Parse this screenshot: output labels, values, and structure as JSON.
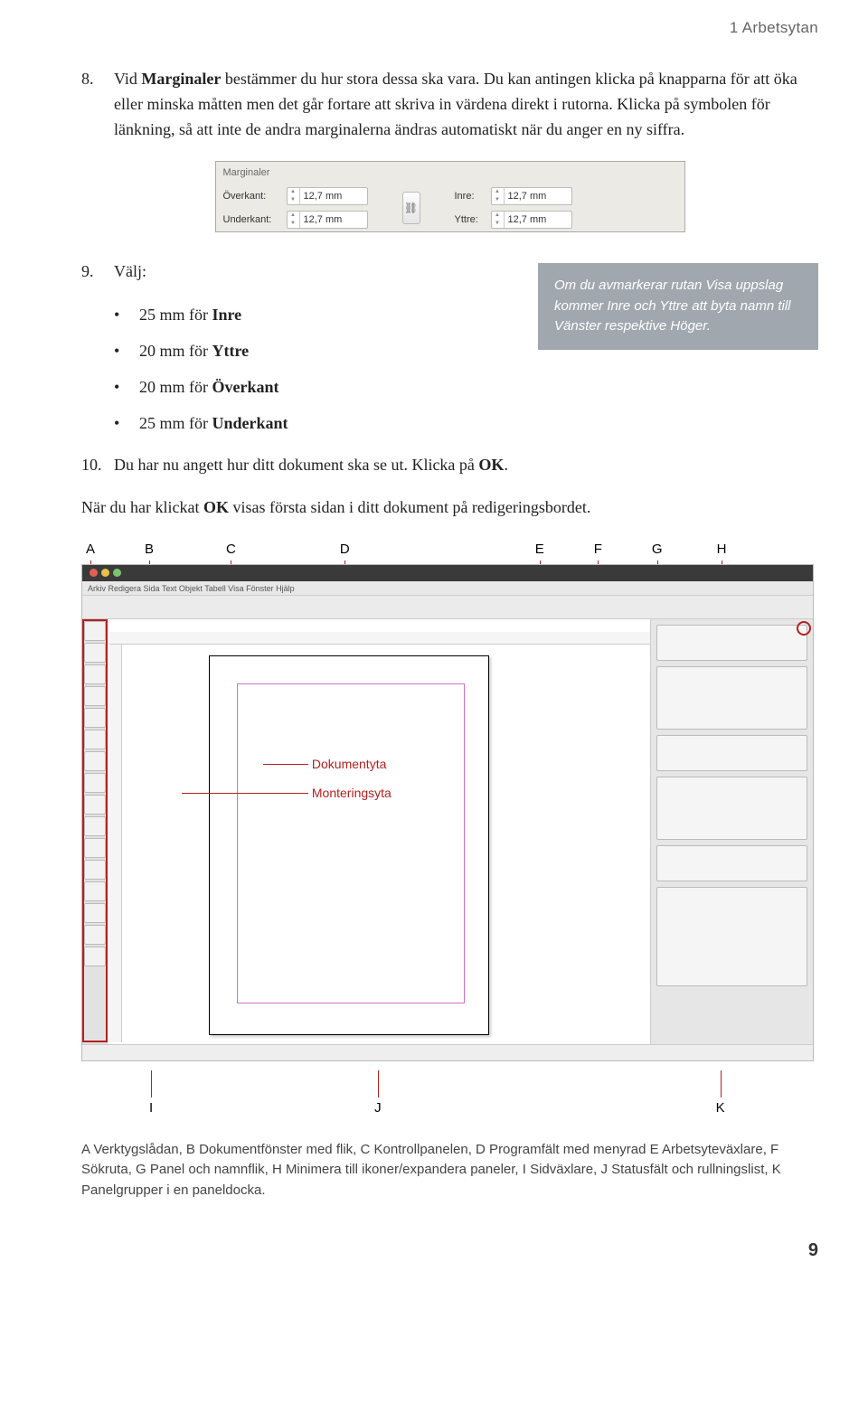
{
  "header": {
    "section_title": "1 Arbetsytan"
  },
  "step8": {
    "num": "8.",
    "text_before_bold": "Vid ",
    "bold1": "Marginaler",
    "text_after": " bestämmer du hur stora dessa ska vara. Du kan antingen klicka på knapparna för att öka eller minska måtten men det går fortare att skriva in värdena direkt i rutorna. Klicka på symbolen för länkning, så att inte de andra marginalerna ändras automatiskt när du anger en ny siffra."
  },
  "margins_panel": {
    "title": "Marginaler",
    "overkant_lbl": "Överkant:",
    "overkant_val": "12,7 mm",
    "underkant_lbl": "Underkant:",
    "underkant_val": "12,7 mm",
    "inre_lbl": "Inre:",
    "inre_val": "12,7 mm",
    "yttre_lbl": "Yttre:",
    "yttre_val": "12,7 mm"
  },
  "step9": {
    "num": "9.",
    "intro": "Välj:",
    "bullets": [
      {
        "prefix": "25 mm för ",
        "bold": "Inre"
      },
      {
        "prefix": "20 mm för ",
        "bold": "Yttre"
      },
      {
        "prefix": "20 mm för ",
        "bold": "Överkant"
      },
      {
        "prefix": "25 mm för ",
        "bold": "Underkant"
      }
    ]
  },
  "note": {
    "text": "Om du avmarkerar rutan Visa uppslag kommer Inre och Yttre att byta namn till Vänster respektive Höger."
  },
  "step10": {
    "num": "10.",
    "text": "Du har nu angett hur ditt dokument ska se ut. Klicka på ",
    "bold": "OK",
    "after": "."
  },
  "para_after": {
    "t1": "När du har klickat ",
    "b": "OK",
    "t2": " visas första sidan i ditt dokument på redigeringsbordet."
  },
  "diagram": {
    "top_labels": [
      "A",
      "B",
      "C",
      "D",
      "E",
      "F",
      "G",
      "H"
    ],
    "bottom_labels": [
      "I",
      "J",
      "K"
    ],
    "callout_doku": "Dokumentyta",
    "callout_mont": "Monteringsyta",
    "menubar": "Arkiv  Redigera  Sida  Text  Objekt  Tabell  Visa  Fönster  Hjälp"
  },
  "caption": {
    "text": "A Verktygslådan, B Dokumentfönster med flik, C Kontrollpanelen, D Programfält med menyrad E Arbetsyteväxlare, F Sökruta, G Panel och namnflik, H Minimera till ikoner/expandera paneler, I Sidväxlare, J Statusfält och rullningslist, K Panelgrupper i en paneldocka."
  },
  "pagenum": "9"
}
